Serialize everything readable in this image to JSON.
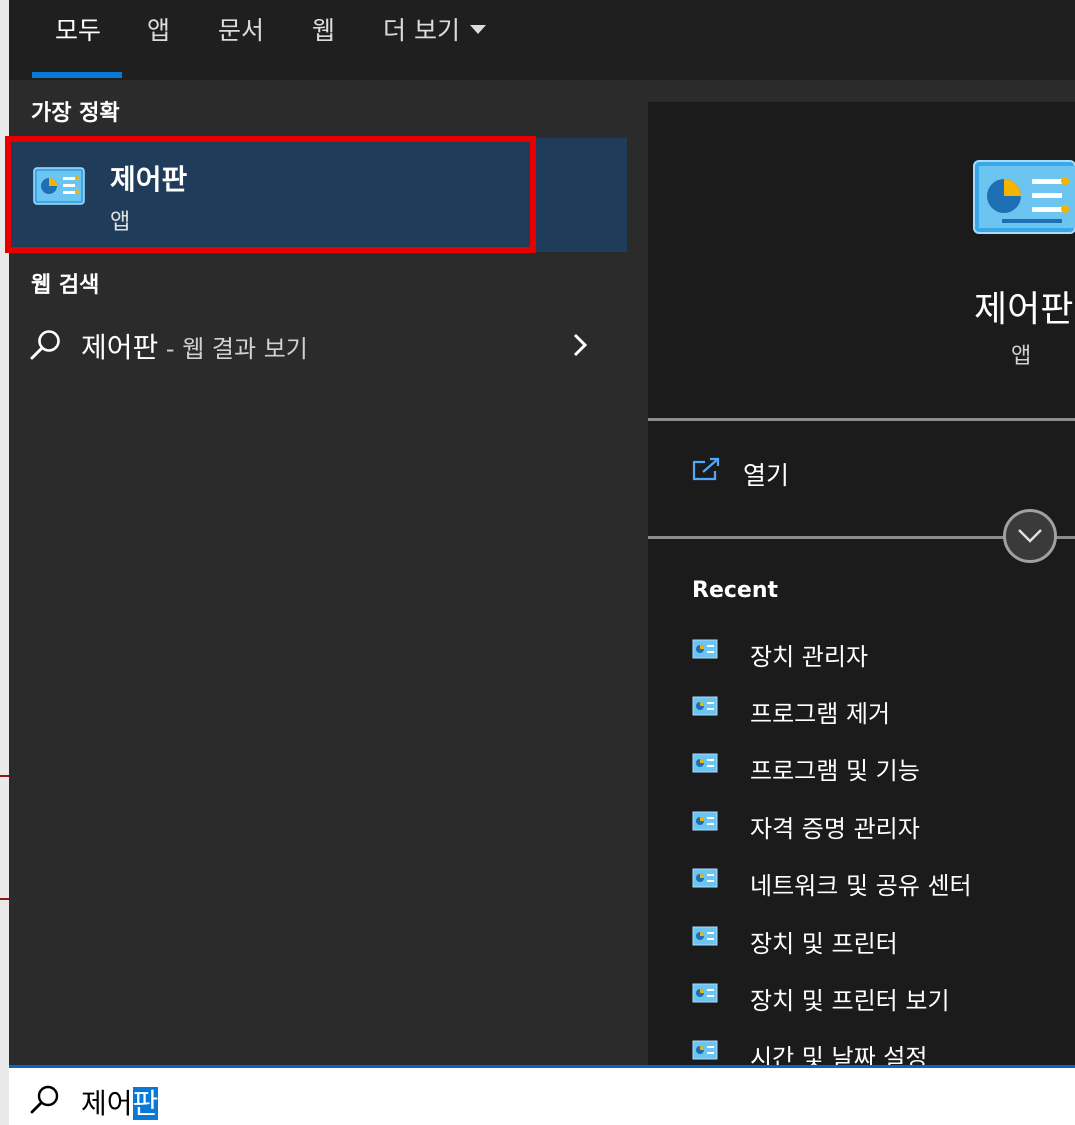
{
  "tabs": [
    {
      "label": "모두",
      "active": true
    },
    {
      "label": "앱",
      "active": false
    },
    {
      "label": "문서",
      "active": false
    },
    {
      "label": "웹",
      "active": false
    },
    {
      "label": "더 보기",
      "active": false
    }
  ],
  "sections": {
    "best_match_title": "가장 정확",
    "web_search_title": "웹 검색"
  },
  "best_match": {
    "title": "제어판",
    "subtitle": "앱",
    "icon": "control-panel-icon"
  },
  "web_search": {
    "query": "제어판",
    "suffix": " - 웹 결과 보기",
    "icon": "search-icon"
  },
  "preview": {
    "title": "제어판",
    "subtitle": "앱",
    "open_label": "열기",
    "recent_title": "Recent",
    "recent_items": [
      {
        "label": "장치 관리자"
      },
      {
        "label": "프로그램 제거"
      },
      {
        "label": "프로그램 및 기능"
      },
      {
        "label": "자격 증명 관리자"
      },
      {
        "label": "네트워크 및 공유 센터"
      },
      {
        "label": "장치 및 프린터"
      },
      {
        "label": "장치 및 프린터 보기"
      },
      {
        "label": "시간 및 날짜 설정"
      }
    ]
  },
  "search_box": {
    "typed": "제어",
    "selected": "판"
  },
  "colors": {
    "accent": "#0a7ad6",
    "highlight_border": "#e60000",
    "selected_bg": "#1f3c5a"
  }
}
